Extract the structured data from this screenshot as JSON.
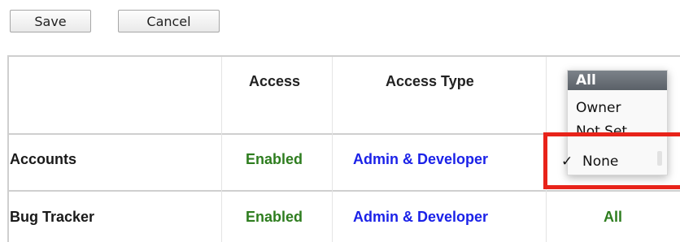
{
  "toolbar": {
    "save_label": "Save",
    "cancel_label": "Cancel"
  },
  "table": {
    "headers": {
      "access": "Access",
      "access_type": "Access Type"
    },
    "rows": [
      {
        "module": "Accounts",
        "access": "Enabled",
        "access_type": "Admin & Developer"
      },
      {
        "module": "Bug Tracker",
        "access": "Enabled",
        "access_type": "Admin & Developer",
        "value": "All"
      }
    ]
  },
  "dropdown": {
    "options": [
      "All",
      "Owner",
      "Not Set",
      "None"
    ],
    "highlighted": "All",
    "checked": "None"
  },
  "colors": {
    "enabled": "#2e7d1f",
    "link": "#1b22e8",
    "highlight_border": "#e8231a"
  }
}
